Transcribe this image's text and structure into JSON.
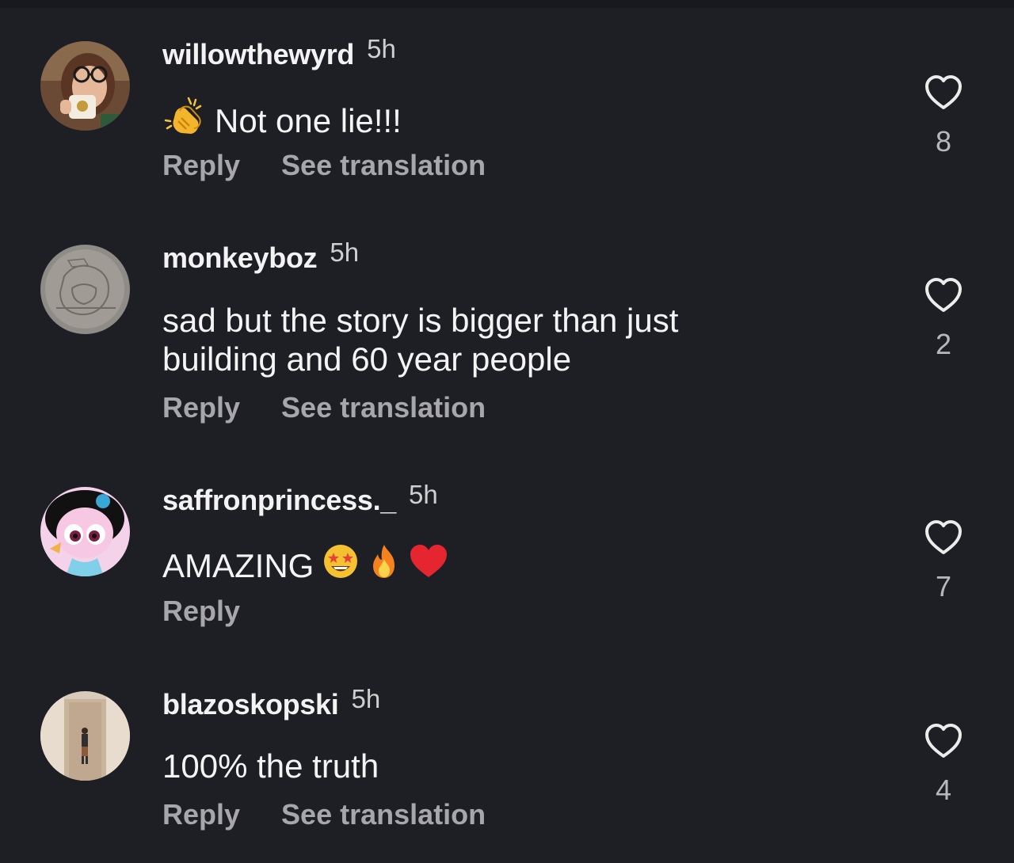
{
  "comments": [
    {
      "username": "willowthewyrd",
      "time": "5h",
      "text": "Not one lie!!!",
      "leading_emoji": "clapping-hands",
      "trailing_emojis": [],
      "actions": [
        "Reply",
        "See translation"
      ],
      "likes": "8"
    },
    {
      "username": "monkeyboz",
      "time": "5h",
      "text": "sad but the story is bigger than just building and 60 year people",
      "leading_emoji": null,
      "trailing_emojis": [],
      "actions": [
        "Reply",
        "See translation"
      ],
      "likes": "2"
    },
    {
      "username": "saffronprincess._",
      "time": "5h",
      "text": "AMAZING",
      "leading_emoji": null,
      "trailing_emojis": [
        "star-struck",
        "fire",
        "red-heart"
      ],
      "actions": [
        "Reply"
      ],
      "likes": "7"
    },
    {
      "username": "blazoskopski",
      "time": "5h",
      "text": "100% the truth",
      "leading_emoji": null,
      "trailing_emojis": [],
      "actions": [
        "Reply",
        "See translation"
      ],
      "likes": "4"
    }
  ],
  "icons": {
    "like": "heart-outline-icon"
  },
  "colors": {
    "background": "#1e1f24",
    "username": "#f3f3f3",
    "secondary": "#a7a7ab",
    "count": "#b8b8bc"
  }
}
